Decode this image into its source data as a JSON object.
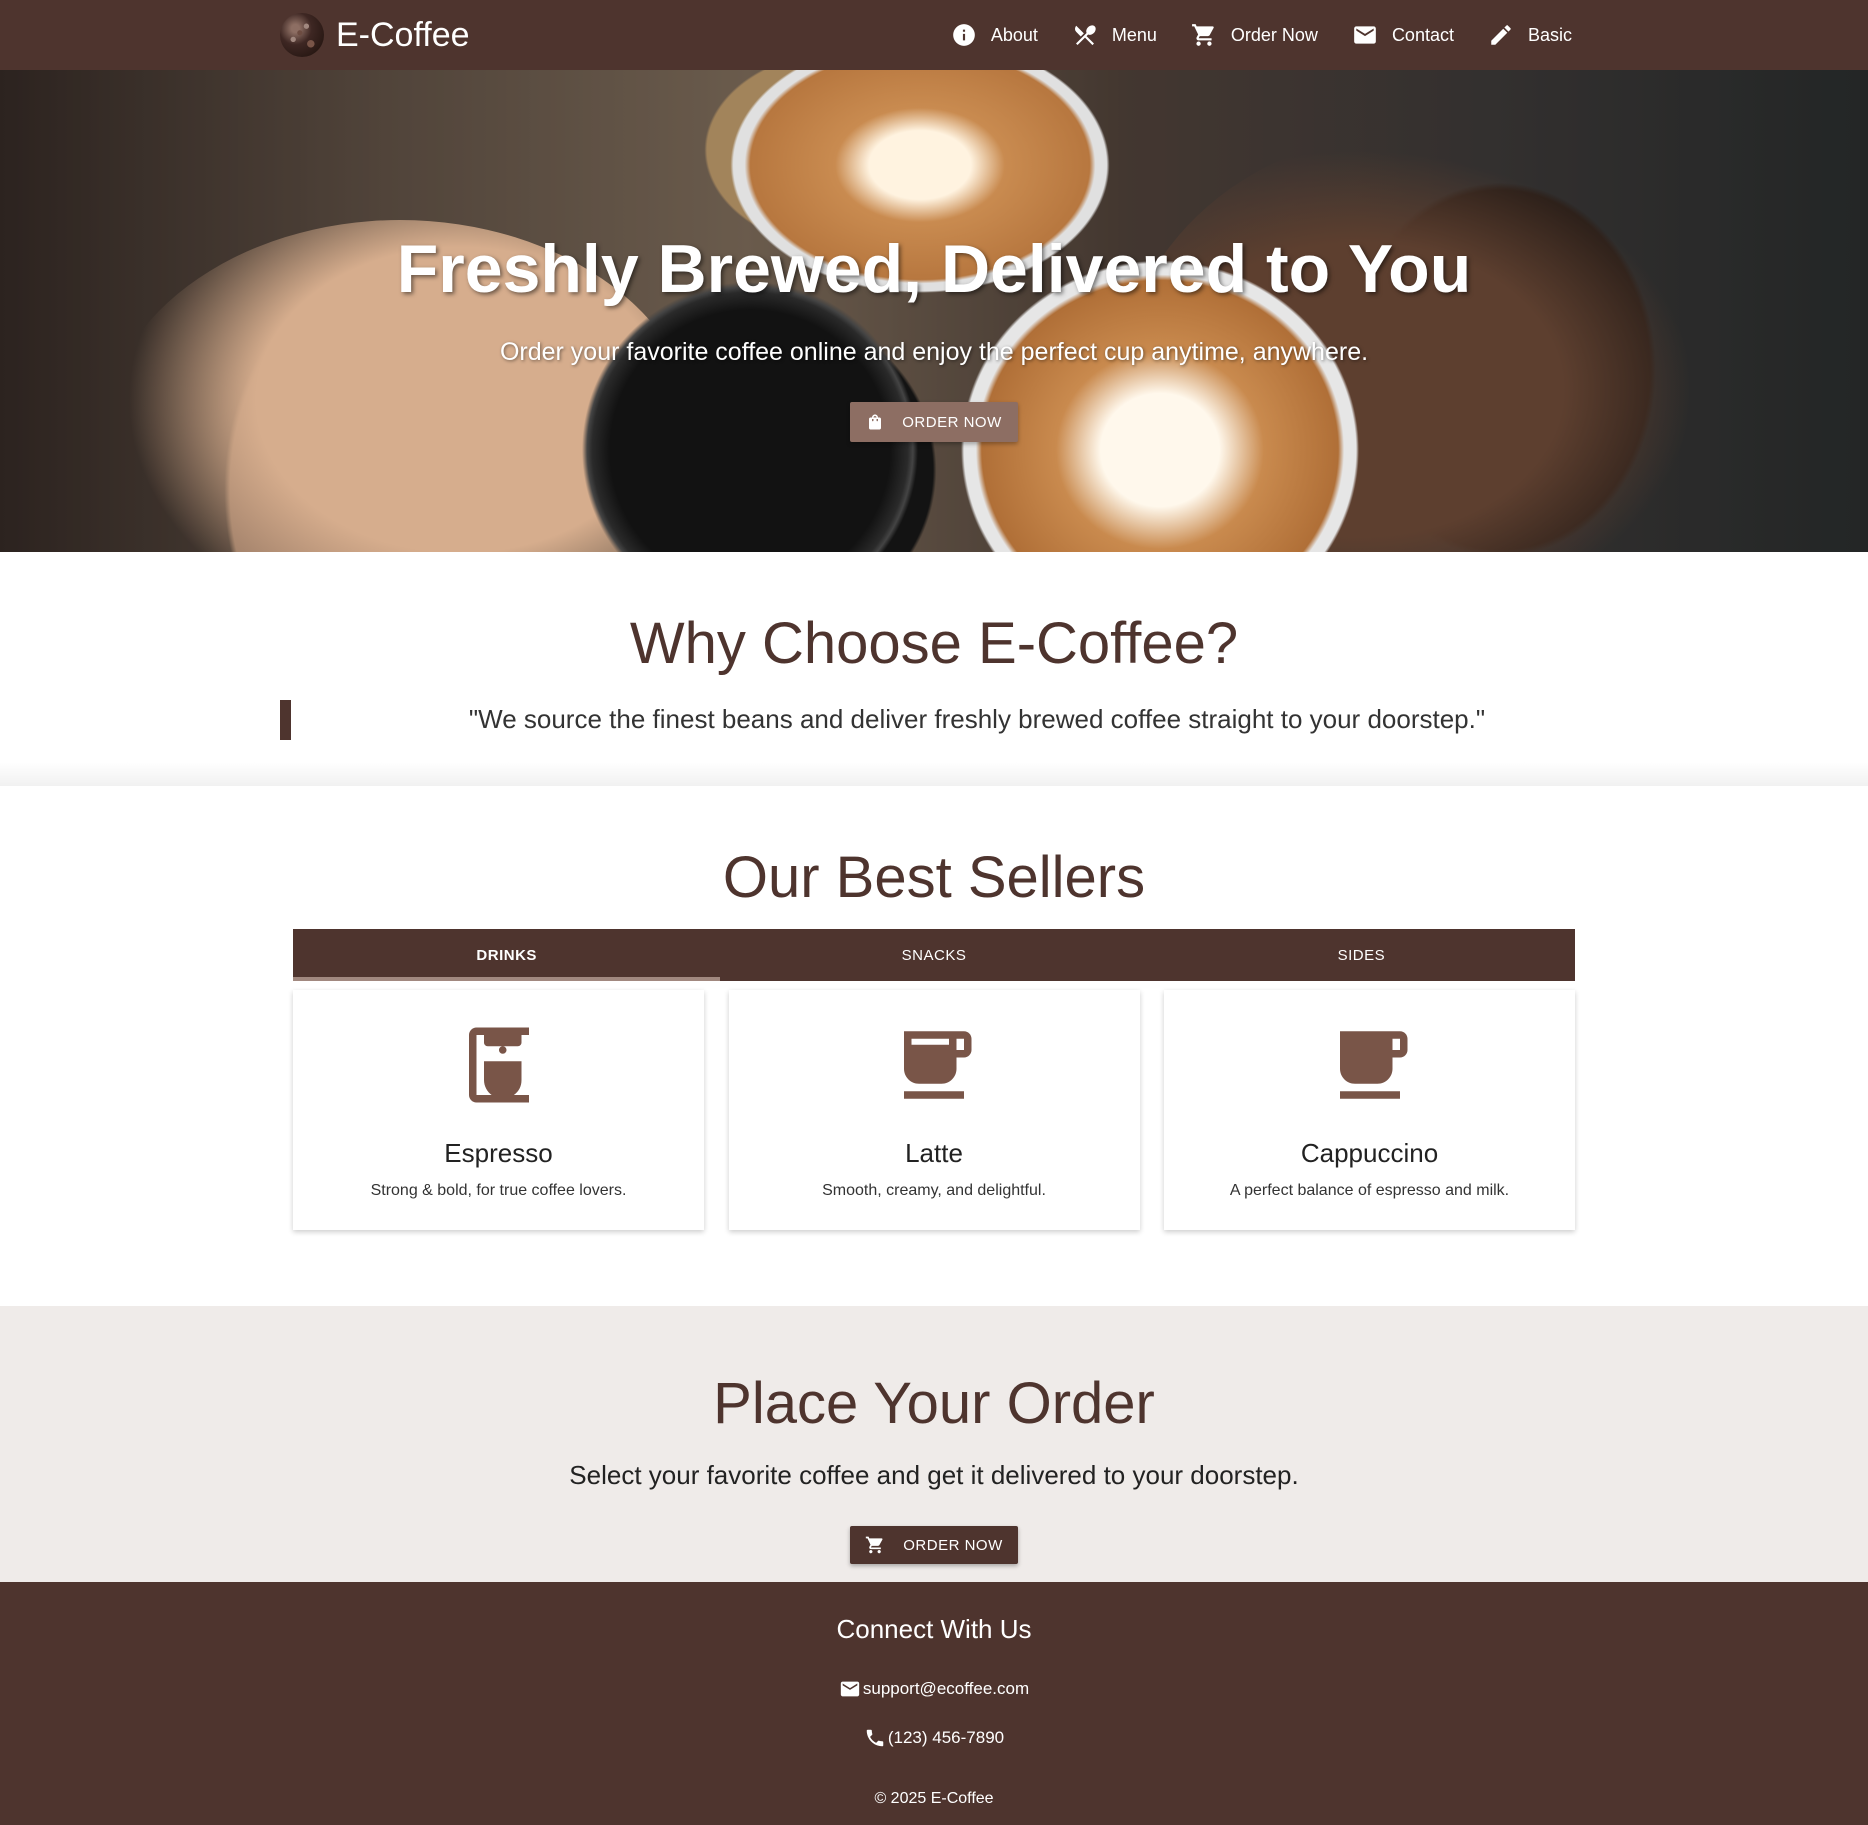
{
  "brand": {
    "name": "E-Coffee",
    "logo_icon": "coffee-beans-logo"
  },
  "nav": {
    "items": [
      {
        "label": "About",
        "icon": "info-icon"
      },
      {
        "label": "Menu",
        "icon": "utensils-icon"
      },
      {
        "label": "Order Now",
        "icon": "cart-icon"
      },
      {
        "label": "Contact",
        "icon": "mail-icon"
      },
      {
        "label": "Basic",
        "icon": "pencil-icon"
      }
    ]
  },
  "hero": {
    "title": "Freshly Brewed, Delivered to You",
    "subtitle": "Order your favorite coffee online and enjoy the perfect cup anytime, anywhere.",
    "button_label": "ORDER NOW",
    "button_icon": "shopping-bag-icon"
  },
  "why": {
    "title": "Why Choose E-Coffee?",
    "quote": "\"We source the finest beans and deliver freshly brewed coffee straight to your doorstep.\""
  },
  "sellers": {
    "title": "Our Best Sellers",
    "tabs": [
      {
        "label": "DRINKS",
        "active": true
      },
      {
        "label": "SNACKS",
        "active": false
      },
      {
        "label": "SIDES",
        "active": false
      }
    ],
    "cards": [
      {
        "name": "Espresso",
        "description": "Strong & bold, for true coffee lovers.",
        "icon": "coffee-maker-icon"
      },
      {
        "name": "Latte",
        "description": "Smooth, creamy, and delightful.",
        "icon": "coffee-cup-icon"
      },
      {
        "name": "Cappuccino",
        "description": "A perfect balance of espresso and milk.",
        "icon": "coffee-mug-icon"
      }
    ]
  },
  "order": {
    "title": "Place Your Order",
    "subtitle": "Select your favorite coffee and get it delivered to your doorstep.",
    "button_label": "ORDER NOW",
    "button_icon": "cart-icon"
  },
  "footer": {
    "title": "Connect With Us",
    "email": "support@ecoffee.com",
    "phone": "(123) 456-7890",
    "copyright": "© 2025 E-Coffee"
  },
  "colors": {
    "primary": "#4e342e",
    "accent": "#8d6e63",
    "icon": "#795548",
    "section_bg": "#efebe9",
    "tab_indicator": "#a1887f"
  }
}
